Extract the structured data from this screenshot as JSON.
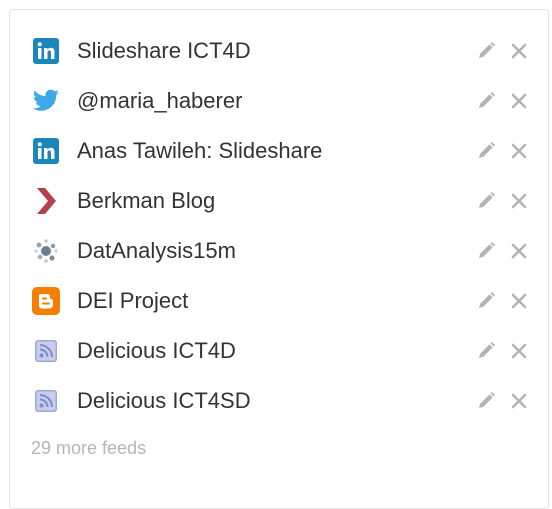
{
  "feeds": [
    {
      "label": "Slideshare ICT4D",
      "icon": "linkedin-icon",
      "icon_color": "#1b86bc"
    },
    {
      "label": "@maria_haberer",
      "icon": "twitter-bird-icon",
      "icon_color": "#3ea9e5"
    },
    {
      "label": "Anas Tawileh: Slideshare",
      "icon": "linkedin-icon",
      "icon_color": "#1b86bc"
    },
    {
      "label": "Berkman Blog",
      "icon": "chevron-right-icon",
      "icon_color": "#b5414f"
    },
    {
      "label": "DatAnalysis15m",
      "icon": "favicon-icon",
      "icon_color": "#7a8a9a"
    },
    {
      "label": "DEI Project",
      "icon": "blogger-icon",
      "icon_color": "#f57d00"
    },
    {
      "label": "Delicious ICT4D",
      "icon": "rss-feed-icon",
      "icon_color": "#9fa9d8"
    },
    {
      "label": "Delicious ICT4SD",
      "icon": "rss-feed-icon",
      "icon_color": "#9fa9d8"
    }
  ],
  "actions": {
    "edit_icon": "pencil-icon",
    "delete_icon": "close-icon",
    "color": "#b3b3b3"
  },
  "more_feeds_label": "29 more feeds"
}
